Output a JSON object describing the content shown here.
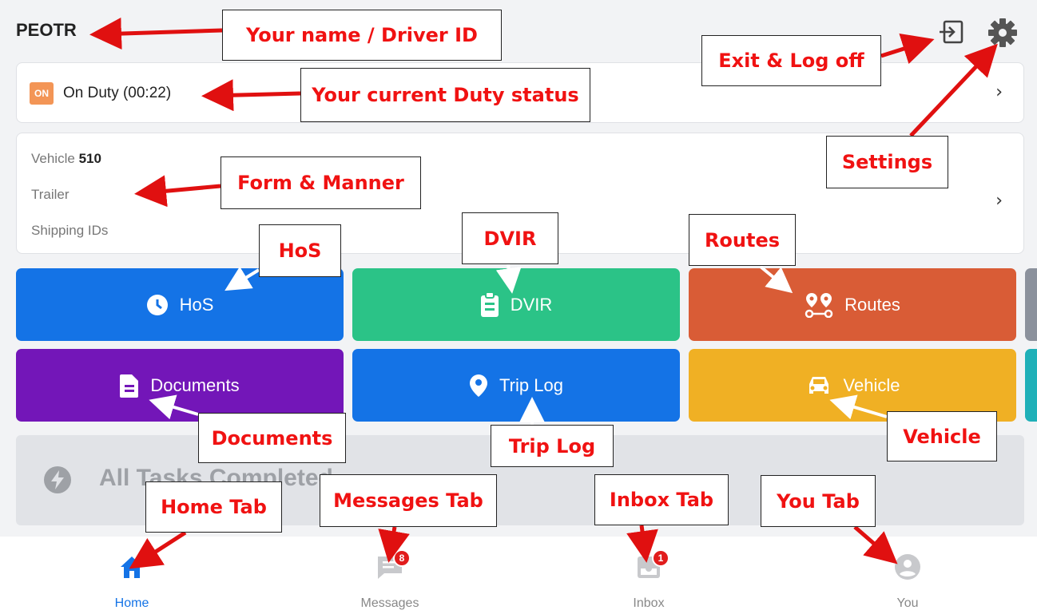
{
  "header": {
    "driver_name": "PEOTR"
  },
  "duty": {
    "badge": "ON",
    "status_text": "On Duty (00:22)"
  },
  "vehicle_card": {
    "vehicle_label": "Vehicle",
    "vehicle_value": "510",
    "trailer_label": "Trailer",
    "shipping_label": "Shipping IDs"
  },
  "tiles": {
    "hos": "HoS",
    "dvir": "DVIR",
    "routes": "Routes",
    "documents": "Documents",
    "trip_log": "Trip Log",
    "vehicle": "Vehicle"
  },
  "tasks": {
    "text": "All Tasks Completed"
  },
  "tabs": {
    "home": "Home",
    "messages": "Messages",
    "messages_badge": "8",
    "inbox": "Inbox",
    "inbox_badge": "1",
    "you": "You"
  },
  "annotations": {
    "name": "Your name / Driver ID",
    "duty": "Your current Duty status",
    "form": "Form & Manner",
    "exit": "Exit & Log off",
    "settings": "Settings",
    "hos": "HoS",
    "dvir": "DVIR",
    "routes": "Routes",
    "documents": "Documents",
    "trip_log": "Trip Log",
    "vehicle": "Vehicle",
    "home_tab": "Home Tab",
    "messages_tab": "Messages Tab",
    "inbox_tab": "Inbox Tab",
    "you_tab": "You Tab"
  },
  "colors": {
    "accent_blue": "#1473e6",
    "dvir_green": "#2bc387",
    "routes_orange": "#d95c36",
    "documents_purple": "#7316b8",
    "vehicle_yellow": "#f0b024",
    "annotation_red": "#f01212"
  },
  "icons": [
    "exit-icon",
    "gear-icon",
    "clock-icon",
    "clipboard-icon",
    "route-icon",
    "document-icon",
    "location-pin-icon",
    "car-icon",
    "bolt-icon",
    "home-icon",
    "message-icon",
    "inbox-icon",
    "user-icon"
  ]
}
